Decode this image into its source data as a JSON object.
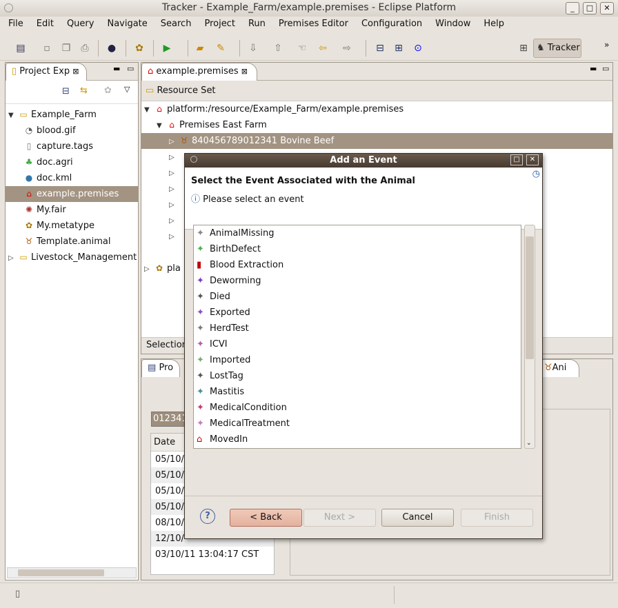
{
  "window": {
    "title": "Tracker - Example_Farm/example.premises - Eclipse Platform"
  },
  "menu": [
    "File",
    "Edit",
    "Query",
    "Navigate",
    "Search",
    "Project",
    "Run",
    "Premises Editor",
    "Configuration",
    "Window",
    "Help"
  ],
  "perspective": {
    "label": "Tracker"
  },
  "project_explorer": {
    "tab": "Project Exp",
    "items": [
      {
        "label": "Example_Farm",
        "icon": "folder-open-icon",
        "level": 0,
        "expanded": true
      },
      {
        "label": "blood.gif",
        "icon": "image-icon",
        "level": 1
      },
      {
        "label": "capture.tags",
        "icon": "file-icon",
        "level": 1
      },
      {
        "label": "doc.agri",
        "icon": "plant-icon",
        "level": 1
      },
      {
        "label": "doc.kml",
        "icon": "globe-icon",
        "level": 1
      },
      {
        "label": "example.premises",
        "icon": "barn-icon",
        "level": 1,
        "selected": true
      },
      {
        "label": "My.fair",
        "icon": "ferris-wheel-icon",
        "level": 1
      },
      {
        "label": "My.metatype",
        "icon": "gears-icon",
        "level": 1
      },
      {
        "label": "Template.animal",
        "icon": "cow-icon",
        "level": 1
      },
      {
        "label": "Livestock_Management",
        "icon": "folder-icon",
        "level": 0,
        "expanded": false
      }
    ]
  },
  "editor": {
    "tab": "example.premises",
    "header": "Resource Set",
    "root": "platform:/resource/Example_Farm/example.premises",
    "premises": "Premises East Farm",
    "animal": "840456789012341 Bovine Beef",
    "other_root": "pla",
    "selection_label": "Selection"
  },
  "bottom": {
    "tab_pro": "Pro",
    "tab_ani": "Ani",
    "id_field": "012341",
    "date_header": "Date",
    "dates": [
      "05/10/",
      "05/10/",
      "05/10/",
      "05/10/",
      "08/10/",
      "12/10/",
      "03/10/11 13:04:17 CST"
    ]
  },
  "dialog": {
    "title": "Add an Event",
    "heading": "Select the Event Associated with the Animal",
    "message": "Please select an event",
    "events": [
      {
        "label": "AnimalMissing",
        "color": "#888888"
      },
      {
        "label": "BirthDefect",
        "color": "#4caf50"
      },
      {
        "label": "Blood Extraction",
        "color": "#c00000",
        "icon": "blood-icon"
      },
      {
        "label": "Deworming",
        "color": "#7b3fbf"
      },
      {
        "label": "Died",
        "color": "#555555"
      },
      {
        "label": "Exported",
        "color": "#8a4fc0"
      },
      {
        "label": "HerdTest",
        "color": "#7a7a7a"
      },
      {
        "label": "ICVI",
        "color": "#b060b0"
      },
      {
        "label": "Imported",
        "color": "#70b070"
      },
      {
        "label": "LostTag",
        "color": "#555555"
      },
      {
        "label": "Mastitis",
        "color": "#4a9090"
      },
      {
        "label": "MedicalCondition",
        "color": "#c04070"
      },
      {
        "label": "MedicalTreatment",
        "color": "#c080c0"
      },
      {
        "label": "MovedIn",
        "color": "#d00000",
        "icon": "barn-arrow-icon"
      }
    ],
    "buttons": {
      "back": "< Back",
      "next": "Next >",
      "cancel": "Cancel",
      "finish": "Finish"
    }
  }
}
